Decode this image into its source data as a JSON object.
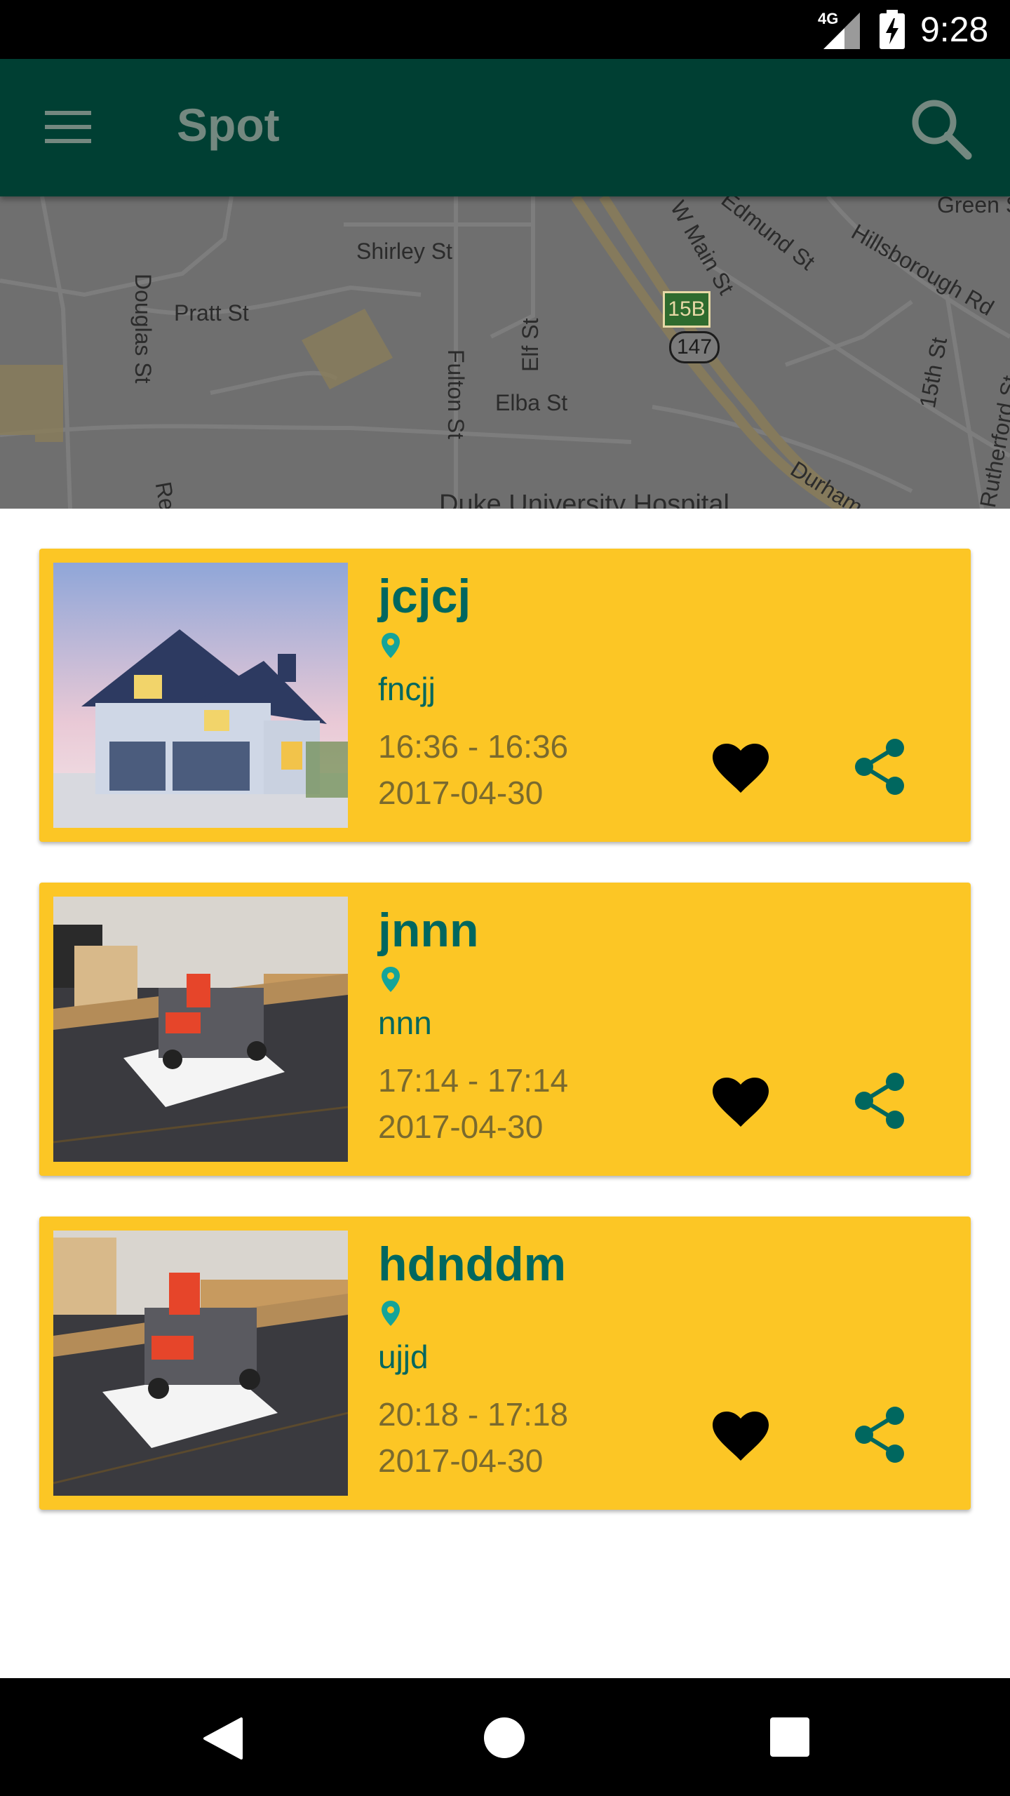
{
  "status_bar": {
    "network": "4G",
    "time": "9:28"
  },
  "app_bar": {
    "title": "Spot",
    "menu_icon": "menu-icon",
    "search_icon": "search-icon"
  },
  "map": {
    "labels": [
      "Shirley St",
      "Pratt St",
      "Douglas St",
      "Fulton St",
      "Elf St",
      "Elba St",
      "W Main St",
      "Edmund St",
      "Hillsborough Rd",
      "15th St",
      "Rutherford St",
      "Green St",
      "Duke University Hospital",
      "Durham",
      "Re"
    ],
    "shield_exit": "15B",
    "shield_route": "147"
  },
  "cards": [
    {
      "title": "jcjcj",
      "subtitle": "fncjj",
      "time": "16:36 - 16:36",
      "date": "2017-04-30",
      "image": "house-photo"
    },
    {
      "title": "jnnn",
      "subtitle": "nnn",
      "time": "17:14 - 17:14",
      "date": "2017-04-30",
      "image": "robot-photo"
    },
    {
      "title": "hdnddm",
      "subtitle": "ujjd",
      "time": "20:18 - 17:18",
      "date": "2017-04-30",
      "image": "robot-photo"
    }
  ],
  "colors": {
    "app_bar": "#003f33",
    "card": "#fcc625",
    "title": "#00675f",
    "teal_icon": "#00675f",
    "heart": "#000000"
  },
  "nav_bar": {
    "icons": [
      "back-icon",
      "home-icon",
      "recents-icon"
    ]
  }
}
